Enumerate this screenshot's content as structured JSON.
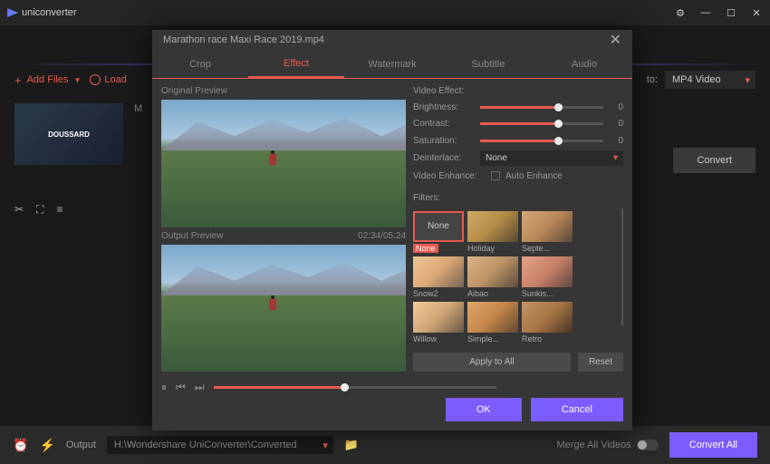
{
  "app": {
    "name": "uniconverter"
  },
  "window_controls": {
    "settings": "⚙",
    "minimize": "—",
    "maximize": "☐",
    "close": "✕"
  },
  "toolbar": {
    "add_files": "Add Files",
    "load": "Load",
    "convert_to_label": "to:",
    "format": "MP4 Video",
    "convert": "Convert"
  },
  "file": {
    "badge": "M"
  },
  "bottom": {
    "output_label": "Output",
    "output_path": "H:\\Wondershare UniConverter\\Converted",
    "merge": "Merge All Videos",
    "convert_all": "Convert All"
  },
  "modal": {
    "filename": "Marathon race  Maxi Race 2019.mp4",
    "tabs": [
      "Crop",
      "Effect",
      "Watermark",
      "Subtitle",
      "Audio"
    ],
    "active_tab": 1,
    "original_label": "Original Preview",
    "output_label": "Output Preview",
    "timecode": "02:34/05:24",
    "effect": {
      "section": "Video Effect:",
      "brightness_label": "Brightness:",
      "brightness_val": "0",
      "contrast_label": "Contrast:",
      "contrast_val": "0",
      "saturation_label": "Saturation:",
      "saturation_val": "0",
      "deinterlace_label": "Deinterlace:",
      "deinterlace_val": "None",
      "enhance_label": "Video Enhance:",
      "auto_enhance": "Auto Enhance"
    },
    "filters": {
      "label": "Filters:",
      "none": "None",
      "items": [
        {
          "name": "None",
          "selected": true
        },
        {
          "name": "Holiday"
        },
        {
          "name": "Septe..."
        },
        {
          "name": "Snow2"
        },
        {
          "name": "Aibao"
        },
        {
          "name": "Sunkis..."
        },
        {
          "name": "Willow"
        },
        {
          "name": "Simple..."
        },
        {
          "name": "Retro"
        }
      ],
      "apply_all": "Apply to All",
      "reset": "Reset"
    },
    "ok": "OK",
    "cancel": "Cancel"
  }
}
